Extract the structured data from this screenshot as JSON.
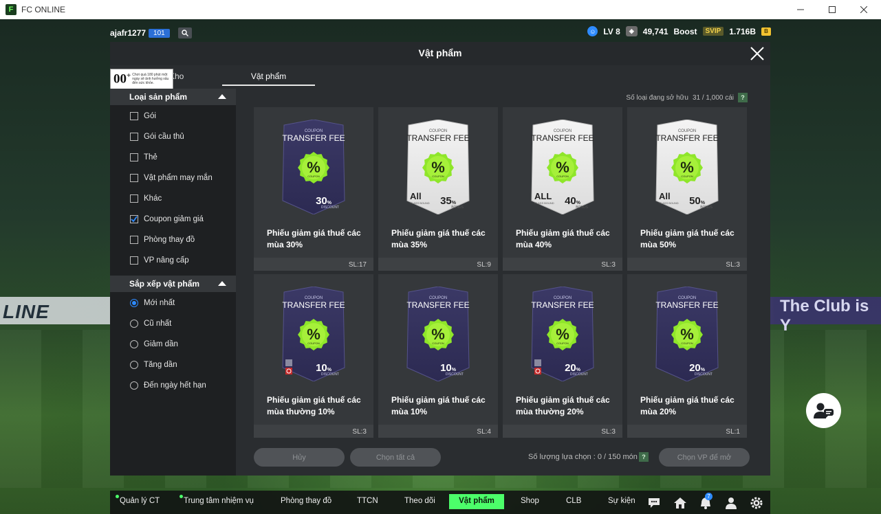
{
  "window": {
    "title": "FC ONLINE",
    "logo": "F"
  },
  "hud": {
    "username": "ajafr1277",
    "level": "101",
    "lv_text": "LV 8",
    "coins": "49,741",
    "boost_label": "Boost",
    "svip": "SVIP",
    "bp": "1.716B"
  },
  "modal": {
    "title": "Vật phẩm",
    "tabs": {
      "kho": "Kho",
      "vatpham": "Vật phẩm"
    },
    "age_badge": {
      "num": "00",
      "plus": "+",
      "text": "Chơi quá 180 phút một ngày sẽ ảnh hưởng xấu đến sức khỏe."
    },
    "owned_label": "Số loại đang sở hữu",
    "owned_value": "31 / 1,000 cái",
    "help": "?"
  },
  "sidebar": {
    "section1": "Loại sản phẩm",
    "filters": [
      {
        "label": "Gói",
        "checked": false
      },
      {
        "label": "Gói cầu thủ",
        "checked": false
      },
      {
        "label": "Thẻ",
        "checked": false
      },
      {
        "label": "Vật phẩm may mắn",
        "checked": false
      },
      {
        "label": "Khác",
        "checked": false
      },
      {
        "label": "Coupon giảm giá",
        "checked": true
      },
      {
        "label": "Phòng thay đồ",
        "checked": false
      },
      {
        "label": "VP nâng cấp",
        "checked": false
      }
    ],
    "section2": "Sắp xếp vật phẩm",
    "sorts": [
      {
        "label": "Mới nhất",
        "selected": true
      },
      {
        "label": "Cũ nhất",
        "selected": false
      },
      {
        "label": "Giảm dần",
        "selected": false
      },
      {
        "label": "Tăng dần",
        "selected": false
      },
      {
        "label": "Đến ngày hết hạn",
        "selected": false
      }
    ]
  },
  "items": [
    {
      "name": "Phiếu giảm giá thuế các mùa 30%",
      "qty": "SL:17",
      "pct": "30",
      "kind": "DISCOUNT",
      "style": "dark",
      "badge": ""
    },
    {
      "name": "Phiếu giảm giá thuế các mùa 35%",
      "qty": "SL:9",
      "pct": "35",
      "kind": "BONUS",
      "style": "white",
      "badge": "All"
    },
    {
      "name": "Phiếu giảm giá thuế các mùa 40%",
      "qty": "SL:3",
      "pct": "40",
      "kind": "BONUS",
      "style": "white",
      "badge": "ALL"
    },
    {
      "name": "Phiếu giảm giá thuế các mùa 50%",
      "qty": "SL:3",
      "pct": "50",
      "kind": "BONUS",
      "style": "white",
      "badge": "All"
    },
    {
      "name": "Phiếu giảm giá thuế các mùa thường 10%",
      "qty": "SL:3",
      "pct": "10",
      "kind": "DISCOUNT",
      "style": "dark",
      "badge": "lock"
    },
    {
      "name": "Phiếu giảm giá thuế các mùa 10%",
      "qty": "SL:4",
      "pct": "10",
      "kind": "DISCOUNT",
      "style": "dark",
      "badge": ""
    },
    {
      "name": "Phiếu giảm giá thuế các mùa thường 20%",
      "qty": "SL:3",
      "pct": "20",
      "kind": "DISCOUNT",
      "style": "dark",
      "badge": "lock"
    },
    {
      "name": "Phiếu giảm giá thuế các mùa 20%",
      "qty": "SL:1",
      "pct": "20",
      "kind": "DISCOUNT",
      "style": "dark",
      "badge": ""
    }
  ],
  "coupon_text": {
    "top": "COUPON",
    "title": "TRANSFER FEE",
    "symbol": "%",
    "seal": "COUPON",
    "pct_sign": "%",
    "class_text": "CLASS BOUND"
  },
  "actions": {
    "cancel": "Hủy",
    "select_all": "Chọn tất cả",
    "selected_count": "Số lượng lựa chọn : 0 / 150 món",
    "open": "Chọn VP để mở"
  },
  "bottom_nav": [
    {
      "label": "Quản lý CT",
      "dot": true
    },
    {
      "label": "Trung tâm nhiệm vụ",
      "dot": true
    },
    {
      "label": "Phòng thay đồ",
      "dot": false
    },
    {
      "label": "TTCN",
      "dot": false
    },
    {
      "label": "Theo dõi",
      "dot": false
    },
    {
      "label": "Vật phẩm",
      "dot": false,
      "active": true
    },
    {
      "label": "Shop",
      "dot": false
    },
    {
      "label": "CLB",
      "dot": false
    },
    {
      "label": "Sự kiện",
      "dot": false
    }
  ],
  "notification_count": "7",
  "background": {
    "banner_left": "LINE",
    "banner_right": "The Club is Y"
  },
  "colors": {
    "accent": "#4cff6a",
    "info": "#2e8bff",
    "coupon_dark": "#3b3966",
    "seal": "#8fe62a"
  }
}
